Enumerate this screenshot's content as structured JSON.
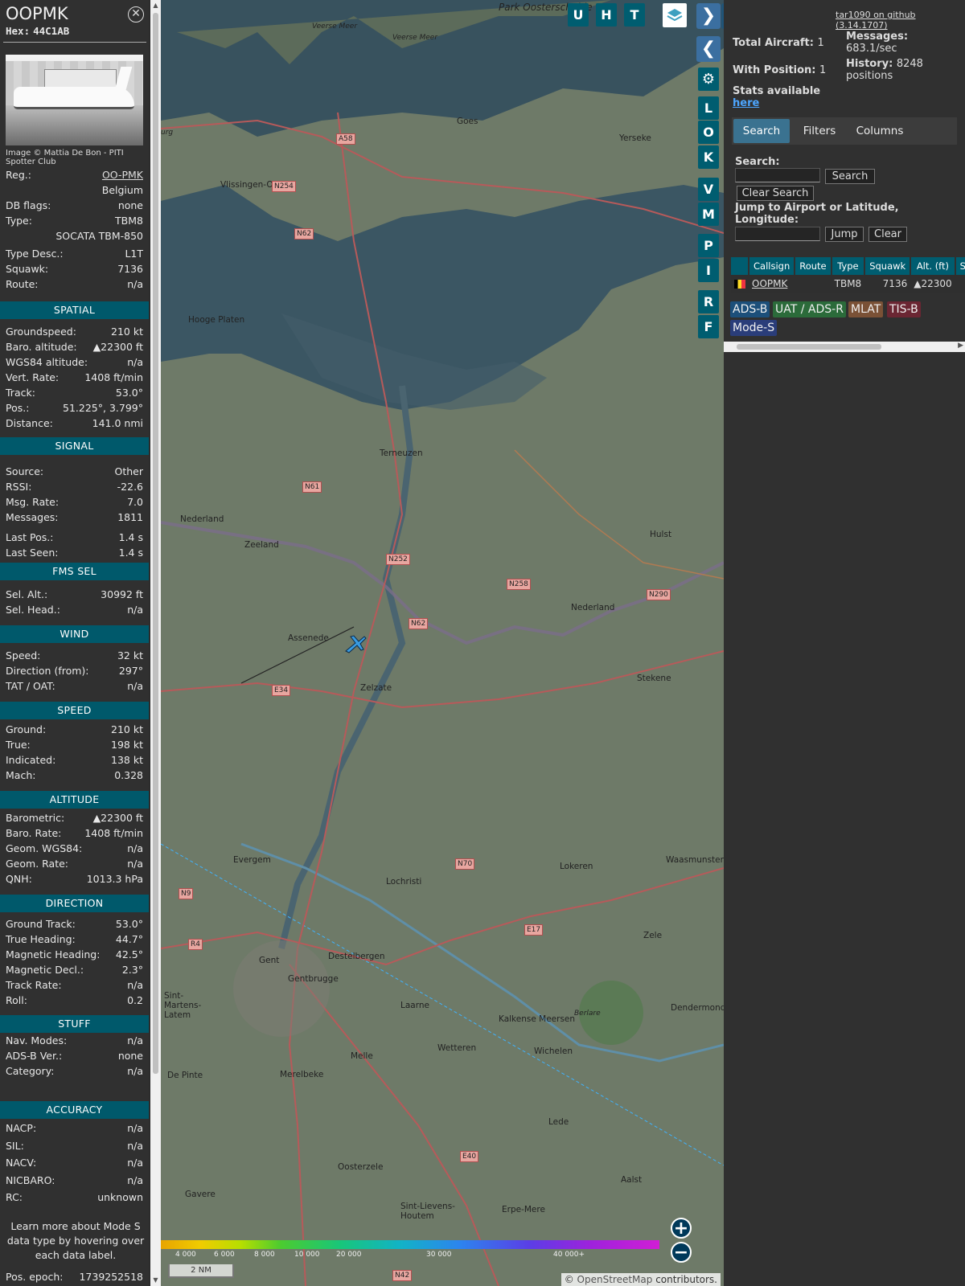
{
  "selected": {
    "callsign": "OOPMK",
    "hex_label": "Hex:",
    "hex": "44C1AB",
    "close_icon": "close-icon",
    "photo_caption": "Image © Mattia De Bon - PITI Spotter Club",
    "info": [
      {
        "label": "Reg.:",
        "value": "OO-PMK",
        "link": true
      },
      {
        "label": "",
        "value": "Belgium"
      },
      {
        "label": "DB flags:",
        "value": "none"
      },
      {
        "label": "Type:",
        "value": "TBM8"
      },
      {
        "label": "",
        "value": "SOCATA TBM-850"
      },
      {
        "label": "Type Desc.:",
        "value": "L1T"
      },
      {
        "label": "Squawk:",
        "value": "7136"
      },
      {
        "label": "Route:",
        "value": "n/a"
      }
    ],
    "sections": [
      {
        "title": "SPATIAL",
        "rows": [
          {
            "label": "Groundspeed:",
            "value": "210 kt"
          },
          {
            "label": "Baro. altitude:",
            "value": "▲22300 ft"
          },
          {
            "label": "WGS84 altitude:",
            "value": "n/a"
          },
          {
            "label": "Vert. Rate:",
            "value": "1408 ft/min"
          },
          {
            "label": "Track:",
            "value": "53.0°"
          },
          {
            "label": "Pos.:",
            "value": "51.225°, 3.799°"
          },
          {
            "label": "Distance:",
            "value": "141.0 nmi"
          }
        ]
      },
      {
        "title": "SIGNAL",
        "rows": [
          {
            "label": "Source:",
            "value": "Other"
          },
          {
            "label": "RSSI:",
            "value": "-22.6"
          },
          {
            "label": "Msg. Rate:",
            "value": "7.0"
          },
          {
            "label": "Messages:",
            "value": "1811"
          },
          {
            "label": "Last Pos.:",
            "value": "1.4 s"
          },
          {
            "label": "Last Seen:",
            "value": "1.4 s"
          }
        ]
      },
      {
        "title": "FMS SEL",
        "rows": [
          {
            "label": "Sel. Alt.:",
            "value": "30992 ft"
          },
          {
            "label": "Sel. Head.:",
            "value": "n/a"
          }
        ]
      },
      {
        "title": "WIND",
        "rows": [
          {
            "label": "Speed:",
            "value": "32 kt"
          },
          {
            "label": "Direction (from):",
            "value": "297°"
          },
          {
            "label": "TAT / OAT:",
            "value": "n/a"
          }
        ]
      },
      {
        "title": "SPEED",
        "rows": [
          {
            "label": "Ground:",
            "value": "210 kt"
          },
          {
            "label": "True:",
            "value": "198 kt"
          },
          {
            "label": "Indicated:",
            "value": "138 kt"
          },
          {
            "label": "Mach:",
            "value": "0.328"
          }
        ]
      },
      {
        "title": "ALTITUDE",
        "rows": [
          {
            "label": "Barometric:",
            "value": "▲22300 ft"
          },
          {
            "label": "Baro. Rate:",
            "value": "1408 ft/min"
          },
          {
            "label": "Geom. WGS84:",
            "value": "n/a"
          },
          {
            "label": "Geom. Rate:",
            "value": "n/a"
          },
          {
            "label": "QNH:",
            "value": "1013.3 hPa"
          }
        ]
      },
      {
        "title": "DIRECTION",
        "rows": [
          {
            "label": "Ground Track:",
            "value": "53.0°"
          },
          {
            "label": "True Heading:",
            "value": "44.7°"
          },
          {
            "label": "Magnetic Heading:",
            "value": "42.5°"
          },
          {
            "label": "Magnetic Decl.:",
            "value": "2.3°"
          },
          {
            "label": "Track Rate:",
            "value": "n/a"
          },
          {
            "label": "Roll:",
            "value": "0.2"
          }
        ]
      },
      {
        "title": "STUFF",
        "rows": [
          {
            "label": "Nav. Modes:",
            "value": "n/a"
          },
          {
            "label": "ADS-B Ver.:",
            "value": "none"
          },
          {
            "label": "Category:",
            "value": "n/a"
          }
        ]
      },
      {
        "title": "ACCURACY",
        "rows": [
          {
            "label": "NACP:",
            "value": "n/a"
          },
          {
            "label": "SIL:",
            "value": "n/a"
          },
          {
            "label": "NACV:",
            "value": "n/a"
          },
          {
            "label": "NICBARO:",
            "value": "n/a"
          },
          {
            "label": "RC:",
            "value": "unknown"
          }
        ]
      }
    ],
    "learn_more": "Learn more about Mode S data type by hovering over each data label.",
    "pos_epoch_label": "Pos. epoch:",
    "pos_epoch": "1739252518"
  },
  "map": {
    "toggle_buttons": [
      "U",
      "H",
      "T"
    ],
    "side_buttons": [
      "L",
      "O",
      "K",
      "V",
      "M",
      "P",
      "I",
      "R",
      "F"
    ],
    "icons": {
      "layers": "layers-icon",
      "next": "chevron-right-icon",
      "prev": "chevron-left-icon",
      "settings": "gear-icon",
      "expand": "expand-icon"
    },
    "zoom_in": "+",
    "zoom_out": "−",
    "scale": "2 NM",
    "attribution_prefix": "©",
    "attribution_link": "OpenStreetMap",
    "attribution_suffix": "contributors.",
    "altitude_ticks": [
      "4 000",
      "6 000",
      "8 000",
      "10 000",
      "20 000",
      "30 000",
      "40 000+"
    ],
    "places": [
      "Park Oosterschelde",
      "Veerse Meer",
      "Veerse Meer",
      "Goes",
      "Yerseke",
      "Vlissingen-Oost",
      "Hooge Platen",
      "Terneuzen",
      "Hulst",
      "Nederland",
      "Zeeland",
      "Nederland",
      "Assenede",
      "Zelzate",
      "Stekene",
      "Evergem",
      "Lochristi",
      "Lokeren",
      "Waasmunster",
      "Gent",
      "Destelbergen",
      "Gentbrugge",
      "Zele",
      "Laarne",
      "Kalkense Meersen",
      "Berlare",
      "Dendermonde",
      "Sint-Martens-Latem",
      "De Pinte",
      "Merelbeke",
      "Melle",
      "Wetteren",
      "Wichelen",
      "Lede",
      "Oosterzele",
      "Aalst",
      "Gavere",
      "Sint-Lievens-Houtem",
      "Erpe-Mere",
      "urg"
    ],
    "roads": [
      "A58",
      "N254",
      "N62",
      "N61",
      "N252",
      "N258",
      "N62",
      "N290",
      "E34",
      "N9",
      "N70",
      "R4",
      "E17",
      "E40",
      "N42"
    ]
  },
  "panel": {
    "github_link": "tar1090 on github (3.14.1707)",
    "total_aircraft_label": "Total Aircraft:",
    "total_aircraft": "1",
    "messages_label": "Messages:",
    "messages": "683.1/sec",
    "with_position_label": "With Position:",
    "with_position": "1",
    "history_label": "History:",
    "history": "8248 positions",
    "stats_label": "Stats available",
    "stats_link": "here",
    "tabs": [
      "Search",
      "Filters",
      "Columns"
    ],
    "search_label": "Search:",
    "search_button": "Search",
    "clear_search_button": "Clear Search",
    "jump_label": "Jump to Airport or Latitude, Longitude:",
    "jump_button": "Jump",
    "clear_button": "Clear",
    "table": {
      "headers": [
        "",
        "Callsign",
        "Route",
        "Type",
        "Squawk",
        "Alt. (ft)",
        "Spd"
      ],
      "rows": [
        {
          "callsign": "OOPMK",
          "route": "",
          "type": "TBM8",
          "squawk": "7136",
          "alt": "▲22300"
        }
      ]
    },
    "legend": [
      {
        "label": "ADS-B",
        "color": "#1c4f7a"
      },
      {
        "label": "UAT / ADS-R",
        "color": "#2b6b3a"
      },
      {
        "label": "MLAT",
        "color": "#7a5136"
      },
      {
        "label": "TIS-B",
        "color": "#6b2633"
      },
      {
        "label": "Mode-S",
        "color": "#2a3d7a"
      }
    ]
  }
}
